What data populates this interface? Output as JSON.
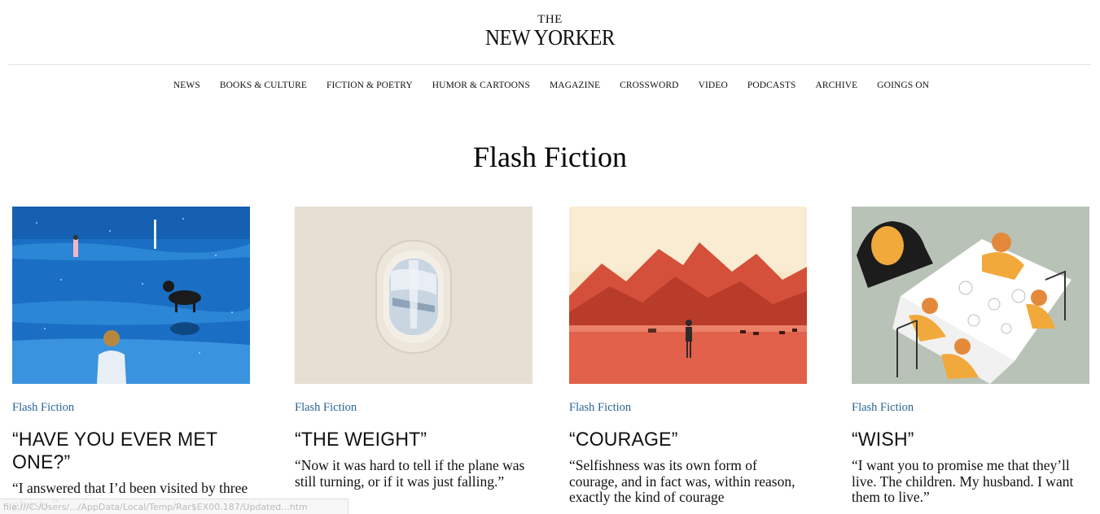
{
  "brand": {
    "the": "THE",
    "name": "NEW YORKER"
  },
  "nav": [
    {
      "label": "NEWS"
    },
    {
      "label": "BOOKS & CULTURE"
    },
    {
      "label": "FICTION & POETRY"
    },
    {
      "label": "HUMOR & CARTOONS"
    },
    {
      "label": "MAGAZINE"
    },
    {
      "label": "CROSSWORD"
    },
    {
      "label": "VIDEO"
    },
    {
      "label": "PODCASTS"
    },
    {
      "label": "ARCHIVE"
    },
    {
      "label": "GOINGS ON"
    }
  ],
  "page": {
    "title": "Flash Fiction"
  },
  "cards": [
    {
      "rubric": "Flash Fiction",
      "headline": "“Have You Ever Met One?”",
      "dek": "“I answered that I’d been visited by three ghosts.”",
      "image": "night-ice-illustration"
    },
    {
      "rubric": "Flash Fiction",
      "headline": "“The Weight”",
      "dek": "“Now it was hard to tell if the plane was still turning, or if it was just falling.”",
      "image": "airplane-window-illustration"
    },
    {
      "rubric": "Flash Fiction",
      "headline": "“Courage”",
      "dek": "“Selfishness was its own form of courage, and in fact was, within reason, exactly the kind of courage",
      "image": "red-mountains-illustration"
    },
    {
      "rubric": "Flash Fiction",
      "headline": "“Wish”",
      "dek": "“I want you to promise me that they’ll live. The children. My husband. I want them to live.”",
      "image": "dinner-table-illustration"
    }
  ],
  "status_url": "file:///C:/Users/.../AppData/Local/Temp/Rar$EX00.187/Updated...htm",
  "colors": {
    "link": "#2a6496",
    "rule": "#e2e2e2"
  }
}
